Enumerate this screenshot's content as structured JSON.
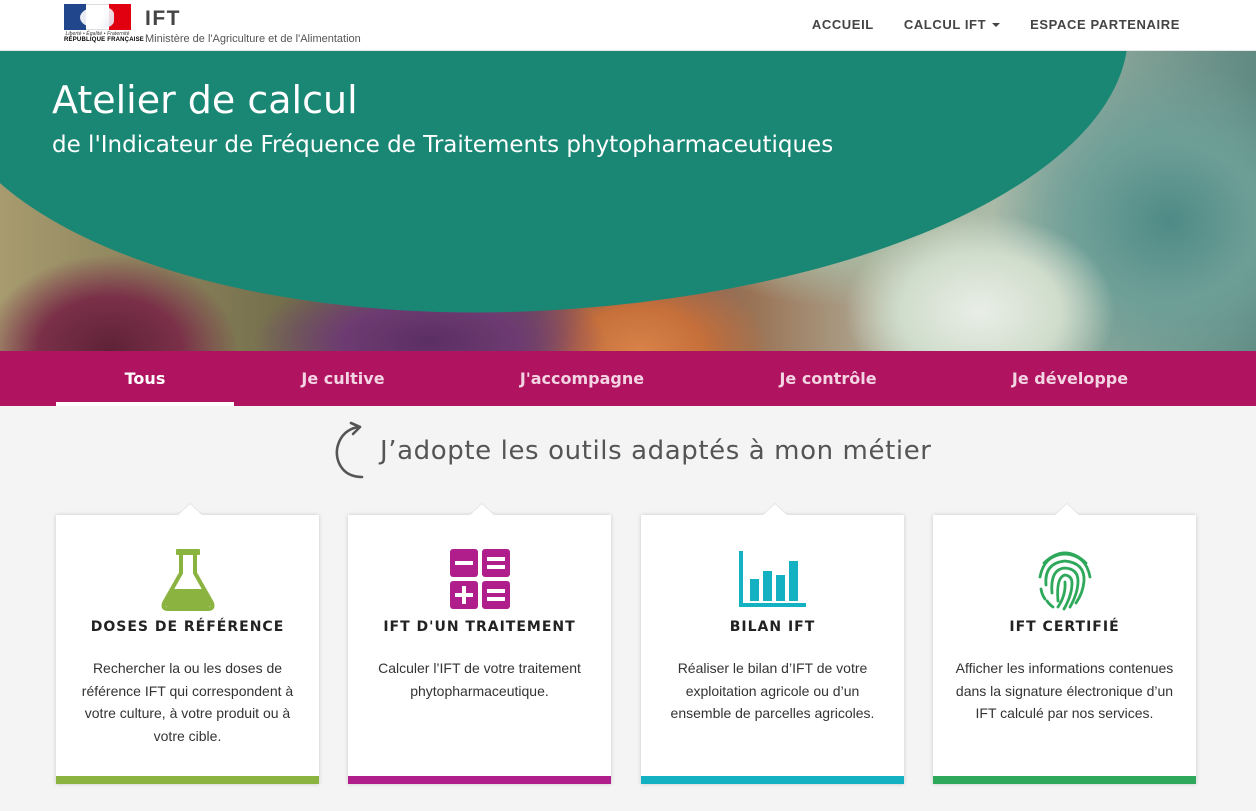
{
  "header": {
    "logo": {
      "devise": "Liberté • Égalité • Fraternité",
      "republique": "RÉPUBLIQUE FRANÇAISE"
    },
    "app_name": "IFT",
    "ministry": "Ministère de l'Agriculture et de l'Alimentation",
    "nav": [
      {
        "label": "ACCUEIL"
      },
      {
        "label": "CALCUL IFT",
        "dropdown": true
      },
      {
        "label": "ESPACE PARTENAIRE"
      }
    ]
  },
  "hero": {
    "title": "Atelier de calcul",
    "subtitle": "de l'Indicateur de Fréquence de Traitements phytopharmaceutiques"
  },
  "tabs": [
    {
      "label": "Tous",
      "active": true
    },
    {
      "label": "Je cultive"
    },
    {
      "label": "J'accompagne"
    },
    {
      "label": "Je contrôle"
    },
    {
      "label": "Je développe"
    }
  ],
  "tagline": "J’adopte les outils adaptés à mon métier",
  "cards": [
    {
      "title": "DOSES DE RÉFÉRENCE",
      "text": "Rechercher la ou les doses de référence IFT qui correspondent à votre culture, à votre produit ou à votre cible.",
      "icon": "flask-icon",
      "color": "#8ab33f"
    },
    {
      "title": "IFT D'UN TRAITEMENT",
      "text": "Calculer l’IFT de votre traitement phytopharmaceutique.",
      "icon": "calculator-icon",
      "color": "#b01e8c"
    },
    {
      "title": "BILAN IFT",
      "text": "Réaliser le bilan d’IFT de votre exploitation agricole ou d’un ensemble de parcelles agricoles.",
      "icon": "bar-chart-icon",
      "color": "#13b1c1"
    },
    {
      "title": "IFT CERTIFIÉ",
      "text": "Afficher les informations contenues dans la signature électronique d’un IFT calculé par nos services.",
      "icon": "fingerprint-icon",
      "color": "#2ea85a"
    }
  ]
}
